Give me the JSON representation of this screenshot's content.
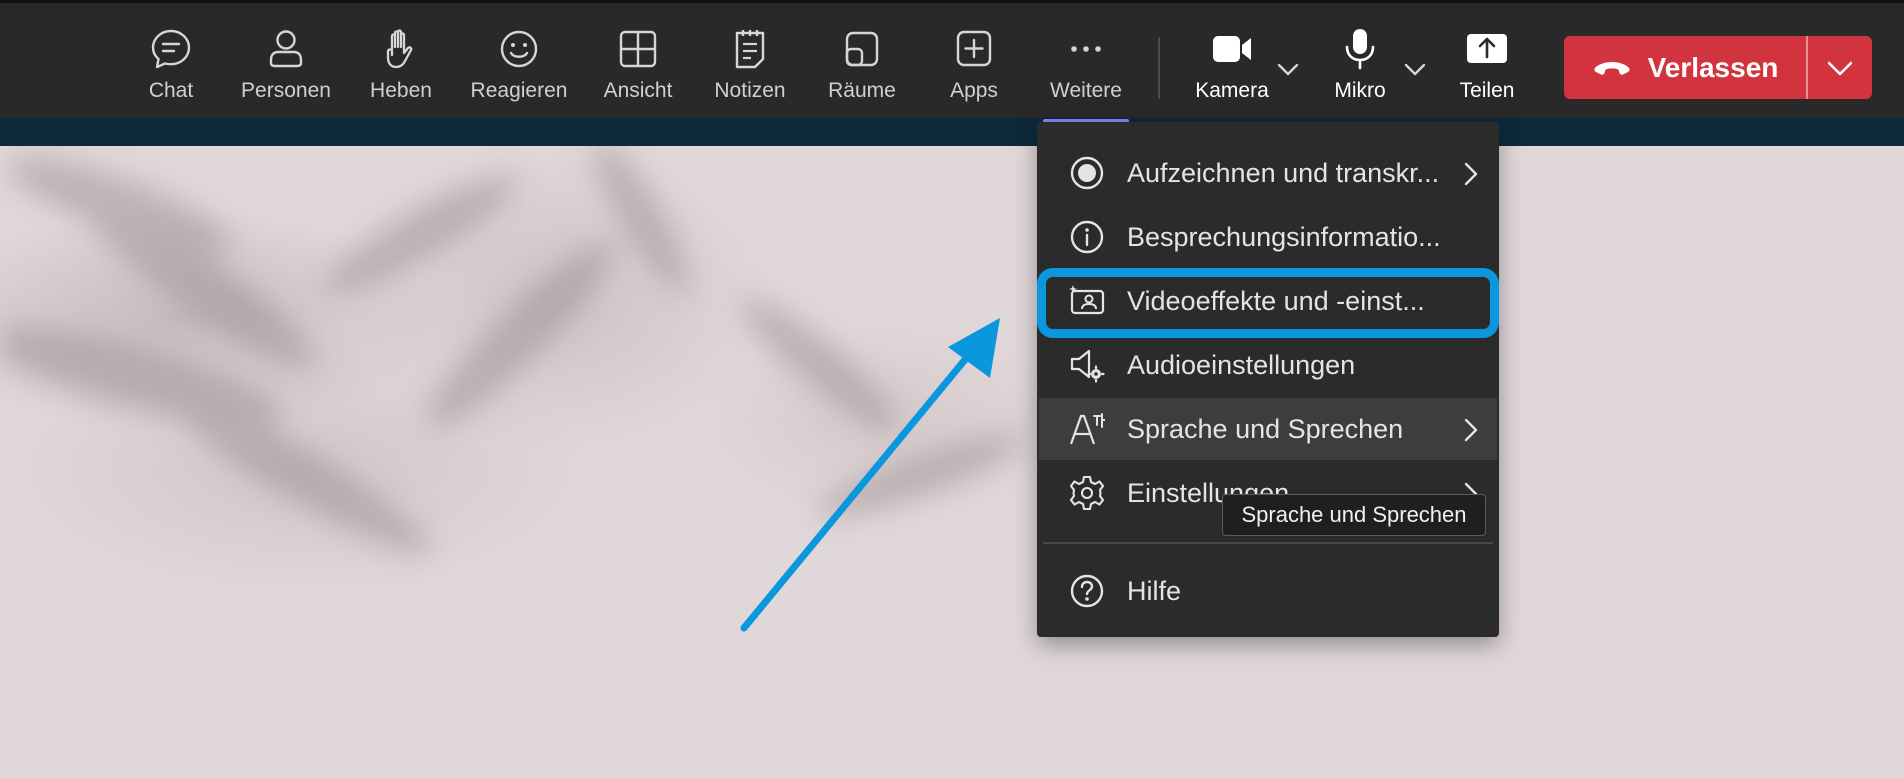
{
  "toolbar": {
    "items": [
      {
        "label": "Chat",
        "icon": "chat-icon"
      },
      {
        "label": "Personen",
        "icon": "people-icon"
      },
      {
        "label": "Heben",
        "icon": "raise-hand-icon"
      },
      {
        "label": "Reagieren",
        "icon": "emoji-icon"
      },
      {
        "label": "Ansicht",
        "icon": "grid-view-icon"
      },
      {
        "label": "Notizen",
        "icon": "notes-icon"
      },
      {
        "label": "Räume",
        "icon": "rooms-icon"
      },
      {
        "label": "Apps",
        "icon": "apps-plus-icon"
      },
      {
        "label": "Weitere",
        "icon": "more-dots-icon"
      }
    ],
    "camera_label": "Kamera",
    "mic_label": "Mikro",
    "share_label": "Teilen",
    "leave_label": "Verlassen"
  },
  "menu": {
    "items": [
      {
        "label": "Aufzeichnen und transkr...",
        "icon": "record-icon",
        "submenu": true
      },
      {
        "label": "Besprechungsinformatio...",
        "icon": "info-icon",
        "submenu": false
      },
      {
        "label": "Videoeffekte und -einst...",
        "icon": "video-effects-icon",
        "submenu": false
      },
      {
        "label": "Audioeinstellungen",
        "icon": "audio-settings-icon",
        "submenu": false
      },
      {
        "label": "Sprache und Sprechen",
        "icon": "language-icon",
        "submenu": true
      },
      {
        "label": "Einstellungen",
        "icon": "gear-icon",
        "submenu": true
      },
      {
        "label": "Hilfe",
        "icon": "help-icon",
        "submenu": false
      }
    ],
    "tooltip": "Sprache und Sprechen"
  },
  "colors": {
    "topbar": "#292929",
    "leave_button": "#d2343f",
    "accent_underline": "#7f85f5",
    "annotation_blue": "#0b97de",
    "menu_bg": "#2b2b2b"
  }
}
